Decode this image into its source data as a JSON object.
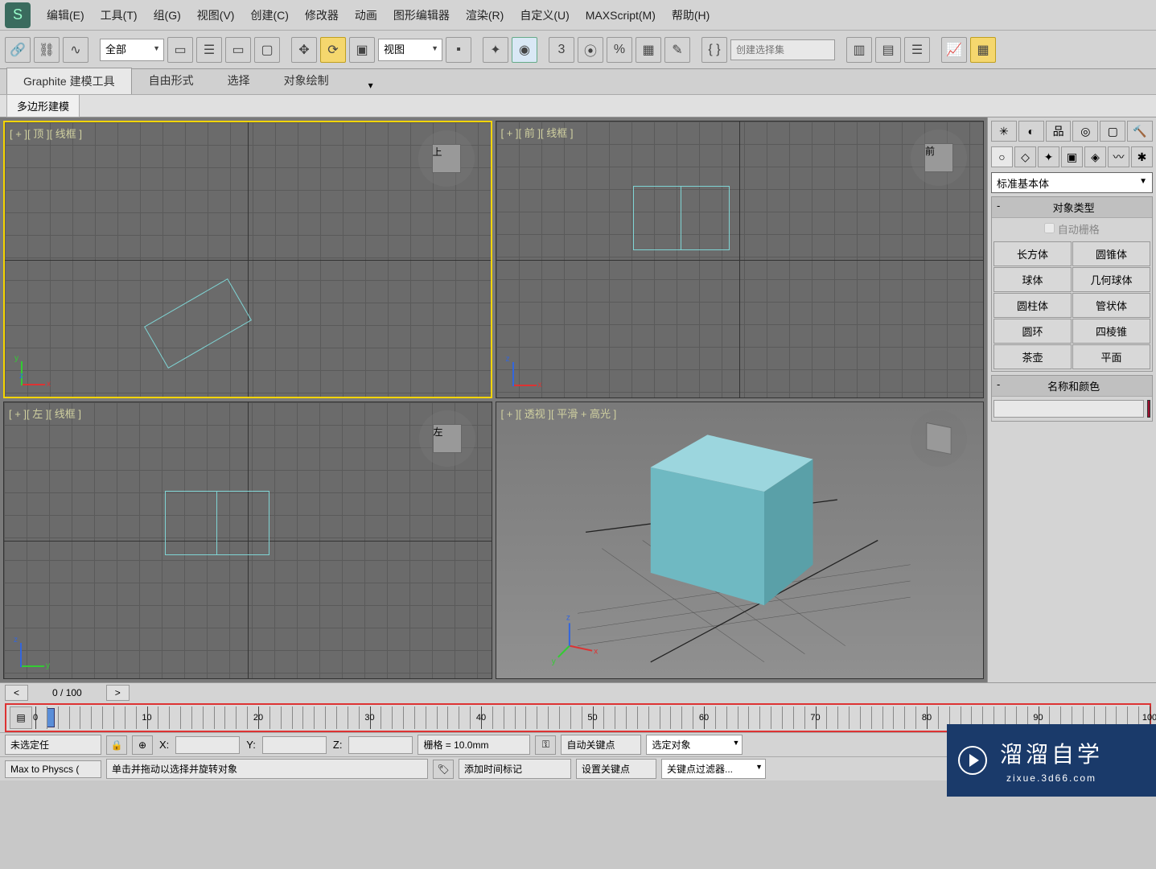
{
  "menu": {
    "items": [
      "编辑(E)",
      "工具(T)",
      "组(G)",
      "视图(V)",
      "创建(C)",
      "修改器",
      "动画",
      "图形编辑器",
      "渲染(R)",
      "自定义(U)",
      "MAXScript(M)",
      "帮助(H)"
    ]
  },
  "toolbar": {
    "all_dropdown": "全部",
    "view_dropdown": "视图",
    "selset_placeholder": "创建选择集"
  },
  "ribbon": {
    "tabs": [
      "Graphite 建模工具",
      "自由形式",
      "选择",
      "对象绘制"
    ],
    "sub_tab": "多边形建模"
  },
  "viewports": {
    "top": "[ + ][ 顶 ][ 线框 ]",
    "front": "[ + ][ 前 ][ 线框 ]",
    "left": "[ + ][ 左 ][ 线框 ]",
    "persp": "[ + ][ 透视 ][ 平滑 + 高光 ]",
    "navcube": {
      "top": "上",
      "front": "前",
      "left": "左"
    }
  },
  "cmdpanel": {
    "category": "标准基本体",
    "rollout_objtype": "对象类型",
    "autogrid": "自动栅格",
    "buttons": [
      "长方体",
      "圆锥体",
      "球体",
      "几何球体",
      "圆柱体",
      "管状体",
      "圆环",
      "四棱锥",
      "茶壶",
      "平面"
    ],
    "rollout_name": "名称和颜色"
  },
  "timeline": {
    "frame": "0 / 100",
    "ticks": [
      0,
      10,
      20,
      30,
      40,
      50,
      60,
      70,
      80,
      90,
      100
    ]
  },
  "status": {
    "noselect": "未选定任",
    "x": "X:",
    "y": "Y:",
    "z": "Z:",
    "grid": "栅格 = 10.0mm",
    "autokey": "自动关键点 选定对象",
    "setkey": "设置关键点 关键点过滤器...",
    "maxphys": "Max to Physcs (",
    "hint": "单击并拖动以选择并旋转对象",
    "addtime": "添加时间标记"
  },
  "watermark": {
    "title": "溜溜自学",
    "sub": "zixue.3d66.com"
  }
}
